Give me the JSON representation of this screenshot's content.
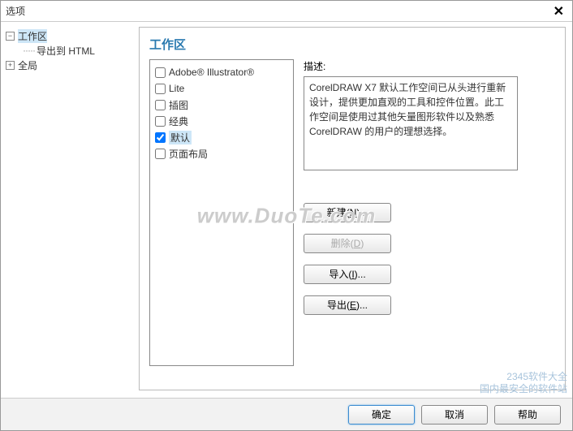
{
  "window": {
    "title": "选项"
  },
  "tree": {
    "root1": "工作区",
    "child1": "导出到 HTML",
    "root2": "全局"
  },
  "section_title": "工作区",
  "workspaces": [
    {
      "label": "Adobe® Illustrator®",
      "checked": false,
      "selected": false
    },
    {
      "label": "Lite",
      "checked": false,
      "selected": false
    },
    {
      "label": "插图",
      "checked": false,
      "selected": false
    },
    {
      "label": "经典",
      "checked": false,
      "selected": false
    },
    {
      "label": "默认",
      "checked": true,
      "selected": true
    },
    {
      "label": "页面布局",
      "checked": false,
      "selected": false
    }
  ],
  "desc_label": "描述:",
  "description": "CorelDRAW X7 默认工作空间已从头进行重新设计，提供更加直观的工具和控件位置。此工作空间是使用过其他矢量图形软件以及熟悉 CorelDRAW 的用户的理想选择。",
  "buttons": {
    "new_": {
      "text": "新建",
      "key": "N"
    },
    "delete_": {
      "text": "删除",
      "key": "D"
    },
    "import_": {
      "text": "导入",
      "key": "I"
    },
    "export_": {
      "text": "导出",
      "key": "E"
    }
  },
  "bottom": {
    "ok": "确定",
    "cancel": "取消",
    "help": "帮助"
  },
  "watermark": "www.DuoTe.com",
  "corner1": "2345软件大全",
  "corner2": "国内最安全的软件站"
}
